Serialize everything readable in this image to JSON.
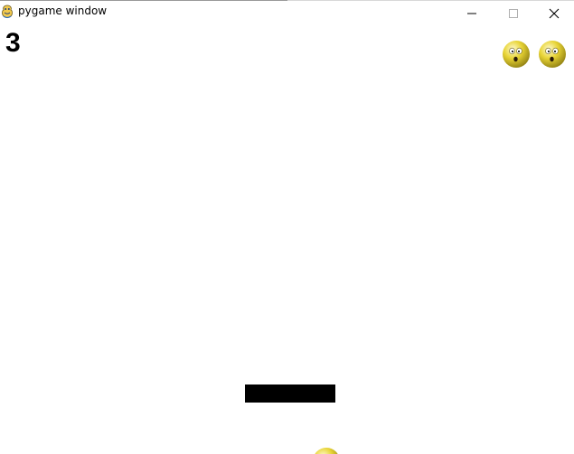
{
  "window": {
    "title": "pygame window",
    "controls": {
      "minimize": "minimize-icon",
      "maximize": "maximize-icon",
      "close": "close-icon"
    }
  },
  "game": {
    "score": "3",
    "lives_remaining": 2,
    "life_icon": "worried-face-icon",
    "ball_icon": "worried-face-icon",
    "colors": {
      "background": "#ffffff",
      "paddle": "#000000",
      "face": "#e8d435"
    }
  }
}
